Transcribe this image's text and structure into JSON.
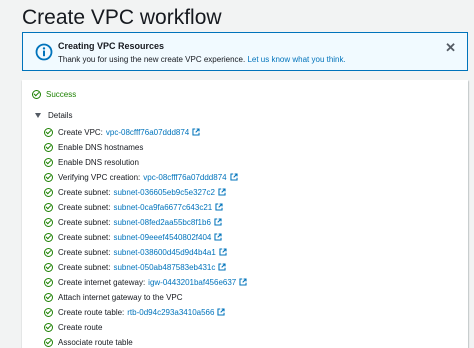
{
  "page": {
    "title": "Create VPC workflow"
  },
  "flash": {
    "icon": "info-icon",
    "title": "Creating VPC Resources",
    "message": "Thank you for using the new create VPC experience.",
    "link": "Let us know what you think.",
    "close_icon": "close-icon",
    "accent_color": "#0073bb"
  },
  "status": {
    "label": "Success",
    "color": "#1d8102"
  },
  "details": {
    "label": "Details",
    "steps": [
      {
        "text": "Create VPC:",
        "id": "vpc-08cfff76a07ddd874",
        "link": true
      },
      {
        "text": "Enable DNS hostnames",
        "id": "",
        "link": false
      },
      {
        "text": "Enable DNS resolution",
        "id": "",
        "link": false
      },
      {
        "text": "Verifying VPC creation:",
        "id": "vpc-08cfff76a07ddd874",
        "link": true
      },
      {
        "text": "Create subnet:",
        "id": "subnet-036605eb9c5e327c2",
        "link": true
      },
      {
        "text": "Create subnet:",
        "id": "subnet-0ca9fa6677c643c21",
        "link": true
      },
      {
        "text": "Create subnet:",
        "id": "subnet-08fed2aa55bc8f1b6",
        "link": true
      },
      {
        "text": "Create subnet:",
        "id": "subnet-09eeef4540802f404",
        "link": true
      },
      {
        "text": "Create subnet:",
        "id": "subnet-038600d45d9d4b4a1",
        "link": true
      },
      {
        "text": "Create subnet:",
        "id": "subnet-050ab487583eb431c",
        "link": true
      },
      {
        "text": "Create internet gateway:",
        "id": "igw-0443201baf456e637",
        "link": true
      },
      {
        "text": "Attach internet gateway to the VPC",
        "id": "",
        "link": false
      },
      {
        "text": "Create route table:",
        "id": "rtb-0d94c293a3410a566",
        "link": true
      },
      {
        "text": "Create route",
        "id": "",
        "link": false
      },
      {
        "text": "Associate route table",
        "id": "",
        "link": false
      }
    ]
  }
}
